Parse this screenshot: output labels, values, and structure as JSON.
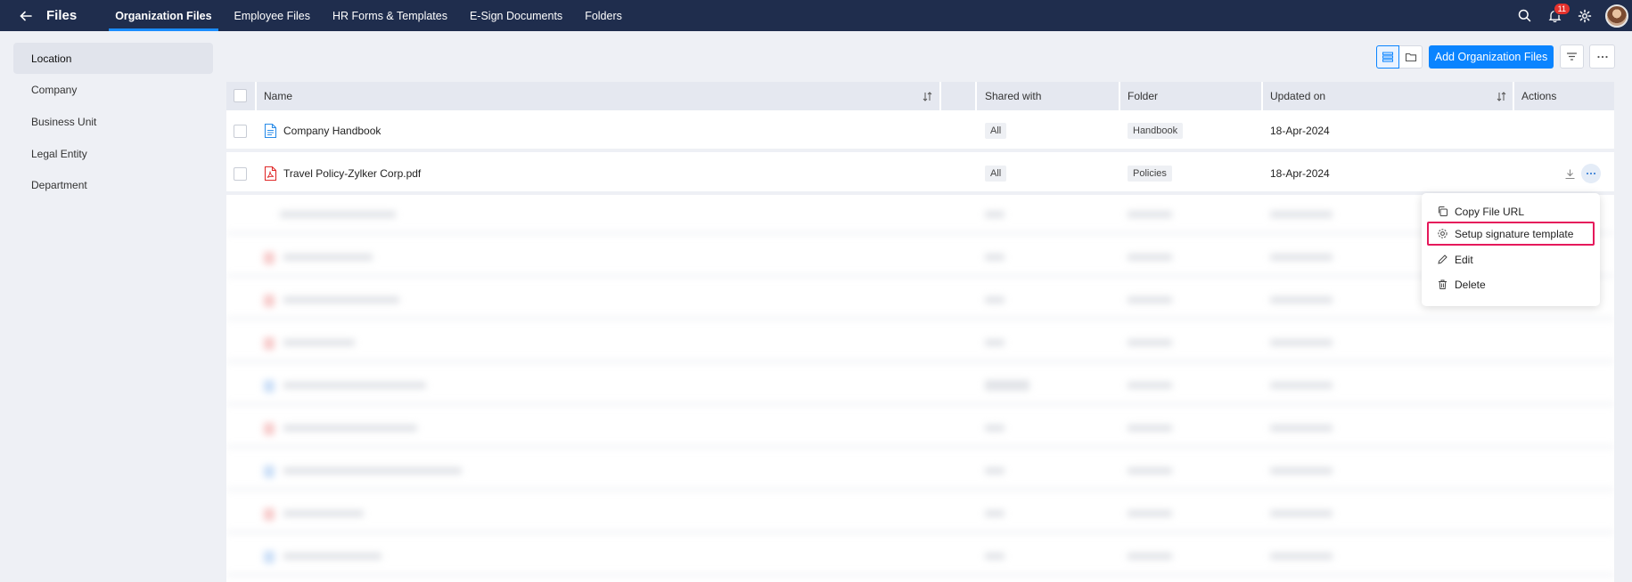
{
  "topbar": {
    "title": "Files",
    "tabs": [
      "Organization Files",
      "Employee Files",
      "HR Forms & Templates",
      "E-Sign Documents",
      "Folders"
    ],
    "notification_count": "11"
  },
  "sidebar": {
    "items": [
      "Location",
      "Company",
      "Business Unit",
      "Legal Entity",
      "Department"
    ]
  },
  "toolbar": {
    "add_label": "Add Organization Files"
  },
  "table": {
    "headers": {
      "name": "Name",
      "shared_with": "Shared with",
      "folder": "Folder",
      "updated_on": "Updated on",
      "actions": "Actions"
    },
    "rows": [
      {
        "name": "Company Handbook",
        "shared_with": "All",
        "folder": "Handbook",
        "updated_on": "18-Apr-2024",
        "file_type": "doc"
      },
      {
        "name": "Travel Policy-Zylker Corp.pdf",
        "shared_with": "All",
        "folder": "Policies",
        "updated_on": "18-Apr-2024",
        "file_type": "pdf"
      }
    ]
  },
  "context_menu": {
    "items": [
      "Copy File URL",
      "Setup signature template",
      "Edit",
      "Delete"
    ]
  },
  "colors": {
    "topbar": "#1f2d4d",
    "accent": "#0a84ff",
    "highlight": "#e5195b"
  }
}
